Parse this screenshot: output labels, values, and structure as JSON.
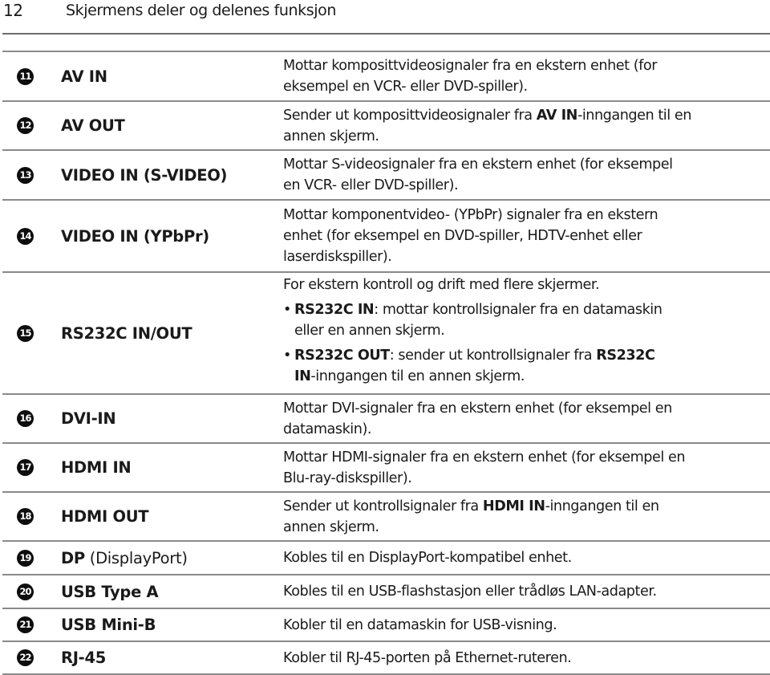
{
  "header": {
    "page_number": "12",
    "title": "Skjermens deler og delenes funksjon"
  },
  "rows": [
    {
      "number": "11",
      "label": "AV IN",
      "description_lines": [
        "Mottar komposittvideosignaler fra en ekstern enhet (for",
        "eksempel en VCR- eller DVD-spiller)."
      ]
    },
    {
      "number": "12",
      "label": "AV OUT",
      "description": {
        "line1_pre": "Sender ut komposittvideosignaler fra ",
        "line1_bold": "AV IN",
        "line1_post": "-inngangen til en",
        "line2": "annen skjerm."
      }
    },
    {
      "number": "13",
      "label": "VIDEO IN (S-VIDEO)",
      "description_lines": [
        "Mottar S-videosignaler fra en ekstern enhet (for eksempel",
        "en VCR- eller DVD-spiller)."
      ]
    },
    {
      "number": "14",
      "label": "VIDEO IN (YPbPr)",
      "description_lines": [
        "Mottar komponentvideo- (YPbPr) signaler fra en ekstern",
        "enhet (for eksempel en DVD-spiller, HDTV-enhet eller",
        "laserdiskspiller)."
      ]
    },
    {
      "number": "15",
      "label": "RS232C IN/OUT",
      "description": {
        "intro": "For ekstern kontroll og drift med flere skjermer.",
        "bullets": [
          {
            "bold": "RS232C IN",
            "line1_post": ": mottar kontrollsignaler fra en datamaskin",
            "line2": "eller en annen skjerm."
          },
          {
            "bold": "RS232C OUT",
            "line1_mid": ": sender ut kontrollsignaler fra ",
            "line1_bold2": "RS232C",
            "line2_bold": "IN",
            "line2_post": "-inngangen til en annen skjerm."
          }
        ],
        "bullet_char": "•"
      }
    },
    {
      "number": "16",
      "label": "DVI-IN",
      "description_lines": [
        "Mottar DVI-signaler fra en ekstern enhet (for eksempel en",
        "datamaskin)."
      ]
    },
    {
      "number": "17",
      "label": "HDMI IN",
      "description_lines": [
        "Mottar HDMI-signaler fra en ekstern enhet (for eksempel en",
        "Blu-ray-diskspiller)."
      ]
    },
    {
      "number": "18",
      "label": "HDMI OUT",
      "description": {
        "line1_pre": "Sender ut kontrollsignaler fra ",
        "line1_bold": "HDMI IN",
        "line1_post": "-inngangen til en",
        "line2": "annen skjerm."
      }
    },
    {
      "number": "19",
      "label_bold": "DP",
      "label_normal": " (DisplayPort)",
      "description_lines": [
        "Kobles til en DisplayPort-kompatibel enhet."
      ]
    },
    {
      "number": "20",
      "label": "USB Type A",
      "description_lines": [
        "Kobles til en USB-flashstasjon eller trådløs LAN-adapter."
      ]
    },
    {
      "number": "21",
      "label": "USB Mini-B",
      "description_lines": [
        "Kobler til en datamaskin for USB-visning."
      ]
    },
    {
      "number": "22",
      "label": "RJ-45",
      "description_lines": [
        "Kobler til RJ-45-porten på Ethernet-ruteren."
      ]
    }
  ]
}
